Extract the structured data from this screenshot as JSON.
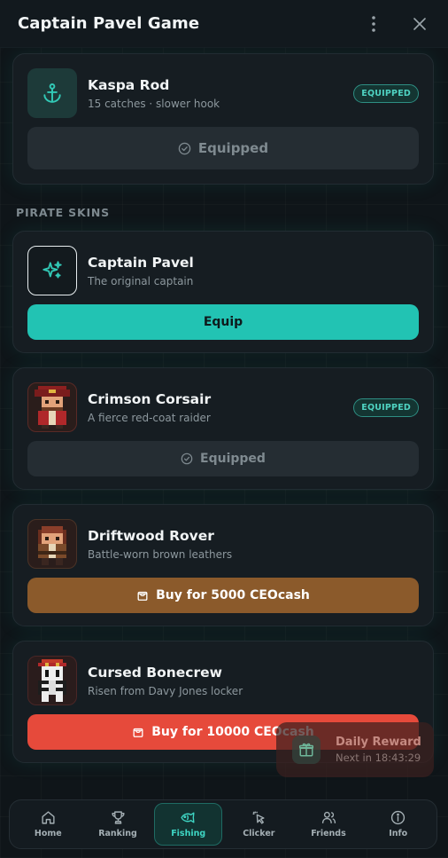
{
  "header": {
    "title": "Captain Pavel Game"
  },
  "rod_card": {
    "name": "Kaspa Rod",
    "desc": "15 catches · slower hook",
    "badge": "EQUIPPED",
    "action_label": "Equipped"
  },
  "skins_section": {
    "label": "PIRATE SKINS"
  },
  "skins": [
    {
      "name": "Captain Pavel",
      "desc": "The original captain",
      "action_label": "Equip"
    },
    {
      "name": "Crimson Corsair",
      "desc": "A fierce red-coat raider",
      "badge": "EQUIPPED",
      "action_label": "Equipped"
    },
    {
      "name": "Driftwood Rover",
      "desc": "Battle-worn brown leathers",
      "action_label": "Buy for 5000 CEOcash"
    },
    {
      "name": "Cursed Bonecrew",
      "desc": "Risen from Davy Jones locker",
      "action_label": "Buy for 10000 CEOcash"
    }
  ],
  "daily_reward": {
    "title": "Daily Reward",
    "subtitle": "Next in 18:43:29"
  },
  "nav": [
    {
      "label": "Home",
      "icon": "home-icon"
    },
    {
      "label": "Ranking",
      "icon": "trophy-icon"
    },
    {
      "label": "Fishing",
      "icon": "fish-icon",
      "active": true
    },
    {
      "label": "Clicker",
      "icon": "pointer-icon"
    },
    {
      "label": "Friends",
      "icon": "users-icon"
    },
    {
      "label": "Info",
      "icon": "info-icon"
    }
  ],
  "colors": {
    "accent": "#22c3b3",
    "buy_brown": "#8b5a2b",
    "buy_red": "#e64a3b",
    "background": "#0f1519"
  }
}
